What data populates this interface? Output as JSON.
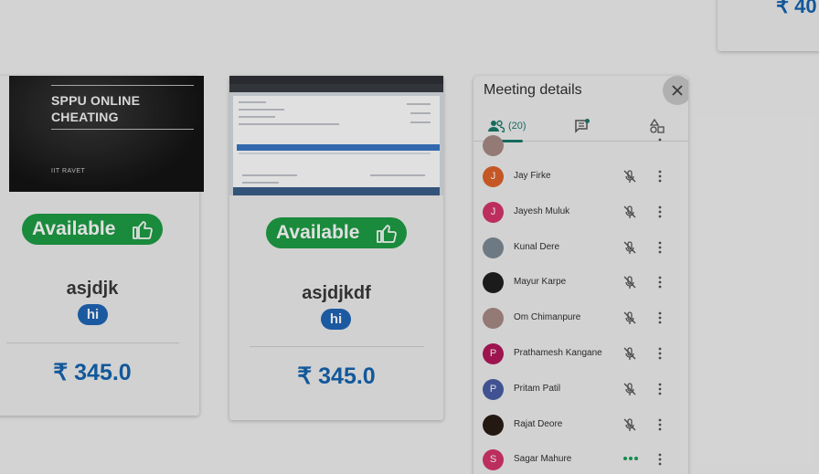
{
  "cards": [
    {
      "thumb_title": "SPPU ONLINE CHEATING",
      "thumb_sub": "IIT RAVET",
      "status": "Available",
      "title": "asjdjk",
      "tag": "hi",
      "price": "₹ 345.0"
    },
    {
      "status": "Available",
      "title": "asjdjkdf",
      "tag": "hi",
      "price": "₹ 345.0"
    }
  ],
  "partial_card": {
    "price": "₹ 40"
  },
  "meeting": {
    "title": "Meeting details",
    "people_count": "(20)",
    "icons": {
      "close": "close-icon",
      "people": "people-icon",
      "chat": "chat-icon",
      "activities": "activities-icon"
    },
    "participants": [
      {
        "name": "Jay Firke",
        "initial": "J",
        "color": "#e0642b",
        "status": "muted"
      },
      {
        "name": "Jayesh Muluk",
        "initial": "J",
        "color": "#d6356b",
        "status": "muted"
      },
      {
        "name": "Kunal Dere",
        "initial": "",
        "color": "#7d8a96",
        "status": "muted"
      },
      {
        "name": "Mayur Karpe",
        "initial": "",
        "color": "#1f1f1f",
        "status": "muted"
      },
      {
        "name": "Om Chimanpure",
        "initial": "",
        "color": "#a88b86",
        "status": "muted"
      },
      {
        "name": "Prathamesh Kangane",
        "initial": "P",
        "color": "#b3175a",
        "status": "muted"
      },
      {
        "name": "Pritam Patil",
        "initial": "P",
        "color": "#4b5ea8",
        "status": "muted"
      },
      {
        "name": "Rajat Deore",
        "initial": "",
        "color": "#2a1c16",
        "status": "muted"
      },
      {
        "name": "Sagar Mahure",
        "initial": "S",
        "color": "#d6356b",
        "status": "speaking"
      }
    ]
  },
  "colors": {
    "available": "#1e9e45",
    "chip": "#1f66b8",
    "price": "#1565b0",
    "accent": "#1a7a6a"
  }
}
